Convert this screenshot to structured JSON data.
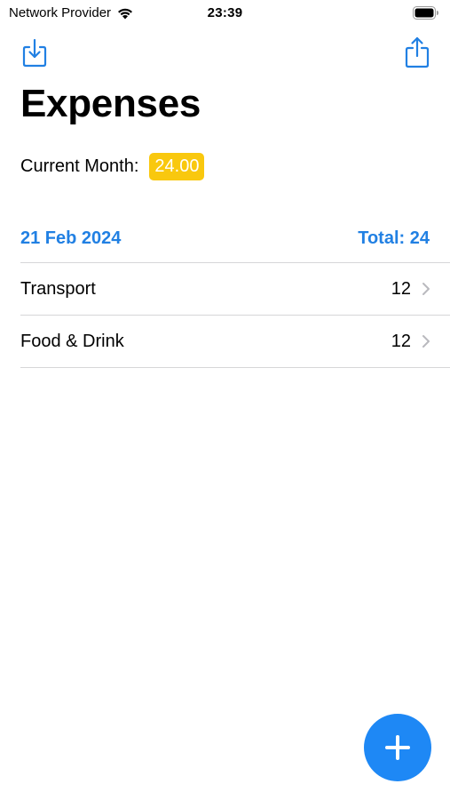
{
  "status_bar": {
    "carrier": "Network Provider",
    "time": "23:39"
  },
  "toolbar": {
    "import_icon": "tray-arrow-down-icon",
    "share_icon": "share-icon"
  },
  "header": {
    "title": "Expenses"
  },
  "current_month": {
    "label": "Current Month:",
    "value": "24.00",
    "badge_color": "#f9c80e"
  },
  "section": {
    "date": "21 Feb 2024",
    "total": "Total: 24",
    "accent_color": "#2180e3"
  },
  "expenses": [
    {
      "category": "Transport",
      "amount": "12"
    },
    {
      "category": "Food & Drink",
      "amount": "12"
    }
  ],
  "fab": {
    "icon": "plus-icon",
    "color": "#1e88f5"
  }
}
